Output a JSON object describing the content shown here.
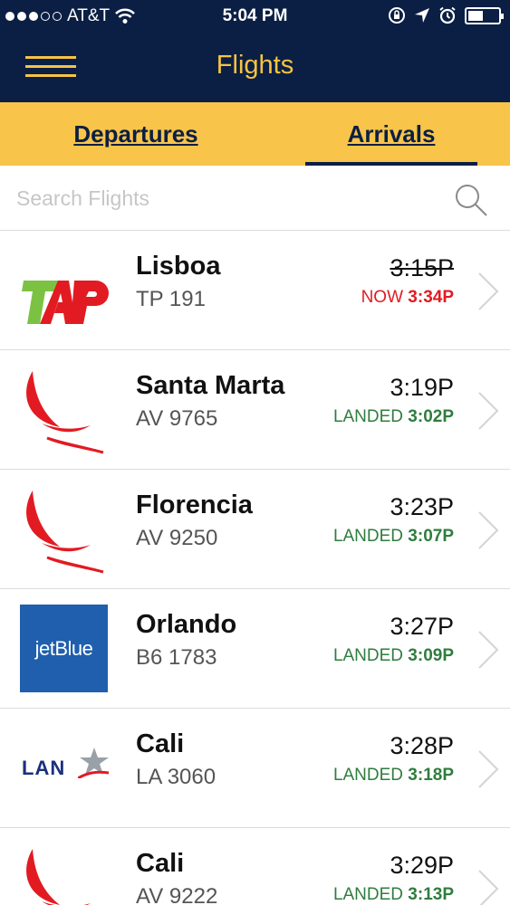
{
  "status_bar": {
    "carrier": "AT&T",
    "time": "5:04 PM"
  },
  "nav": {
    "title": "Flights"
  },
  "tabs": {
    "departures": "Departures",
    "arrivals": "Arrivals",
    "selected": "Arrivals"
  },
  "search": {
    "placeholder": "Search Flights"
  },
  "colors": {
    "navy": "#0b1f44",
    "gold": "#f6c343",
    "delay_red": "#e21b22",
    "landed_green": "#2f7d3e"
  },
  "flights": [
    {
      "airline_logo": "tap-logo",
      "city": "Lisboa",
      "flight": "TP 191",
      "scheduled": "3:15P",
      "scheduled_struck": true,
      "status_word": "NOW",
      "status_time": "3:34P",
      "status_type": "delayed"
    },
    {
      "airline_logo": "avianca-logo",
      "city": "Santa Marta",
      "flight": "AV 9765",
      "scheduled": "3:19P",
      "scheduled_struck": false,
      "status_word": "LANDED",
      "status_time": "3:02P",
      "status_type": "landed"
    },
    {
      "airline_logo": "avianca-logo",
      "city": "Florencia",
      "flight": "AV 9250",
      "scheduled": "3:23P",
      "scheduled_struck": false,
      "status_word": "LANDED",
      "status_time": "3:07P",
      "status_type": "landed"
    },
    {
      "airline_logo": "jetblue-logo",
      "logo_text": "jetBlue",
      "city": "Orlando",
      "flight": "B6 1783",
      "scheduled": "3:27P",
      "scheduled_struck": false,
      "status_word": "LANDED",
      "status_time": "3:09P",
      "status_type": "landed"
    },
    {
      "airline_logo": "lan-logo",
      "logo_text": "LAN",
      "city": "Cali",
      "flight": "LA 3060",
      "scheduled": "3:28P",
      "scheduled_struck": false,
      "status_word": "LANDED",
      "status_time": "3:18P",
      "status_type": "landed"
    },
    {
      "airline_logo": "avianca-logo",
      "city": "Cali",
      "flight": "AV 9222",
      "scheduled": "3:29P",
      "scheduled_struck": false,
      "status_word": "LANDED",
      "status_time": "3:13P",
      "status_type": "landed"
    }
  ]
}
